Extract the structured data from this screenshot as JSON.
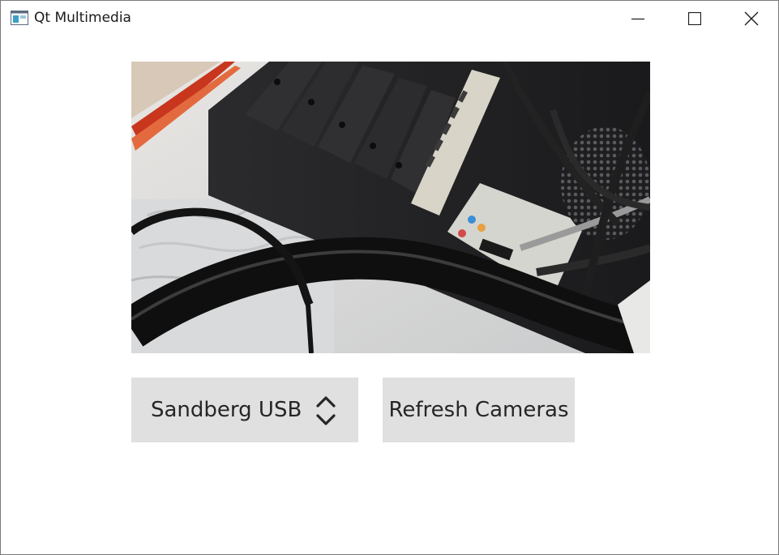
{
  "window": {
    "title": "Qt Multimedia",
    "controls": {
      "minimize_icon": "minimize-icon",
      "maximize_icon": "maximize-icon",
      "close_icon": "close-icon"
    }
  },
  "camera": {
    "selected_device": "Sandberg USB",
    "refresh_label": "Refresh Cameras"
  },
  "colors": {
    "button_bg": "#e0e0e0",
    "text": "#262626",
    "window_bg": "#ffffff"
  }
}
